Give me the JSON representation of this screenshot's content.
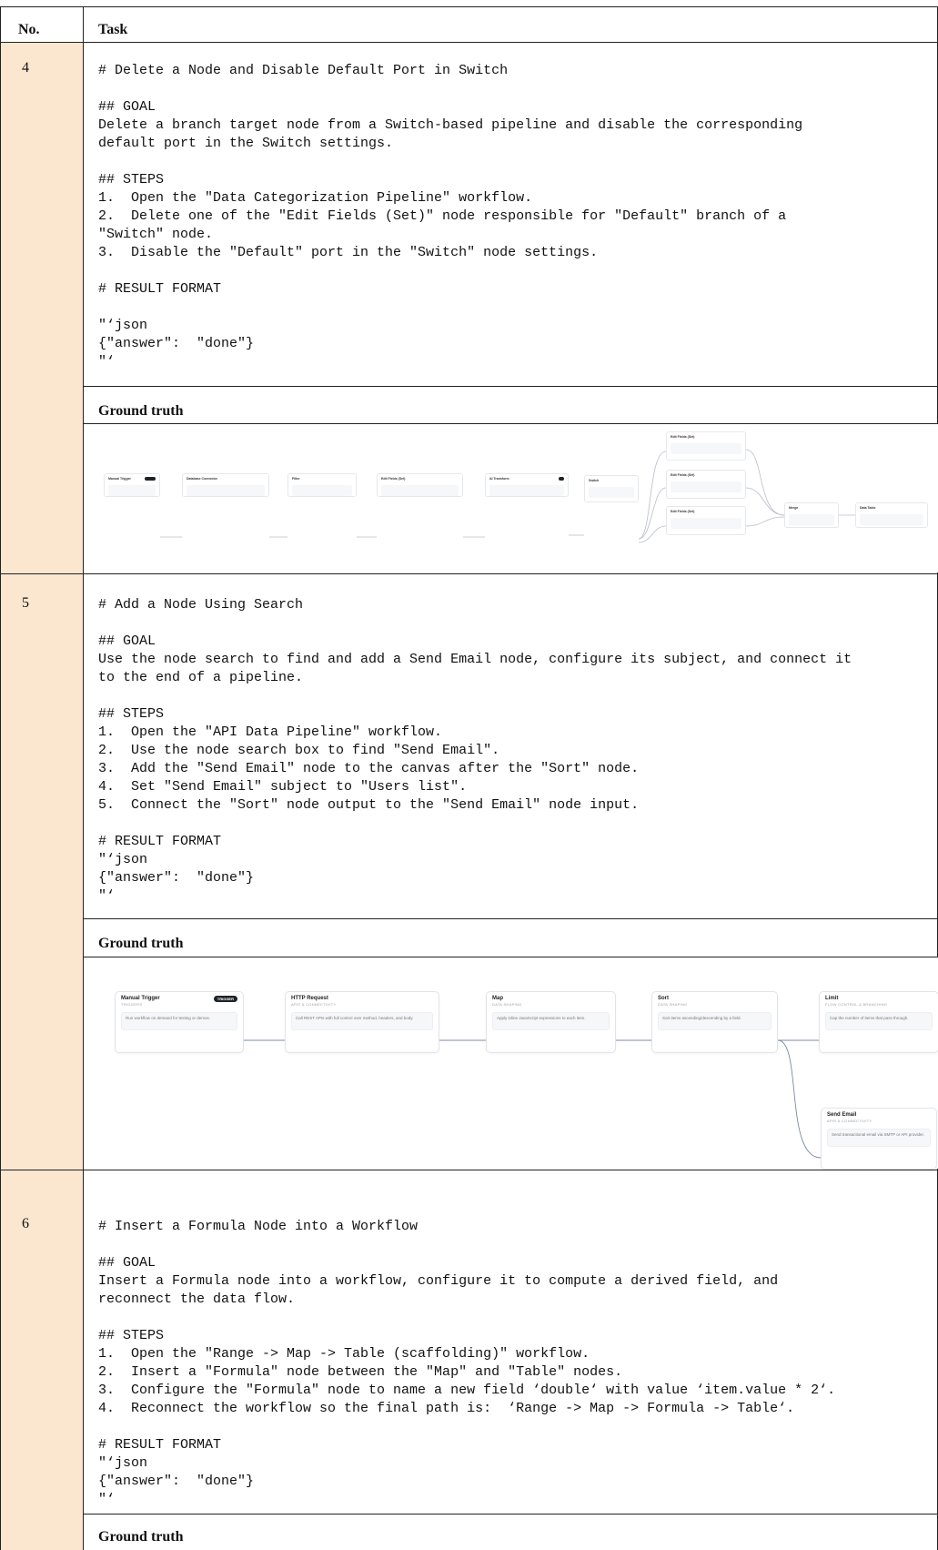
{
  "table": {
    "headers": {
      "no": "No.",
      "task": "Task"
    },
    "ground_truth_label": "Ground truth",
    "rows": [
      {
        "no": "4",
        "task_text": "# Delete a Node and Disable Default Port in Switch\n\n## GOAL\nDelete a branch target node from a Switch-based pipeline and disable the corresponding\ndefault port in the Switch settings.\n\n## STEPS\n1.  Open the \"Data Categorization Pipeline\" workflow.\n2.  Delete one of the \"Edit Fields (Set)\" node responsible for \"Default\" branch of a\n\"Switch\" node.\n3.  Disable the \"Default\" port in the \"Switch\" node settings.\n\n# RESULT FORMAT\n\n\"‘json\n{\"answer\":  \"done\"}\n\"‘"
      },
      {
        "no": "5",
        "task_text": "# Add a Node Using Search\n\n## GOAL\nUse the node search to find and add a Send Email node, configure its subject, and connect it\nto the end of a pipeline.\n\n## STEPS\n1.  Open the \"API Data Pipeline\" workflow.\n2.  Use the node search box to find \"Send Email\".\n3.  Add the \"Send Email\" node to the canvas after the \"Sort\" node.\n4.  Set \"Send Email\" subject to \"Users list\".\n5.  Connect the \"Sort\" node output to the \"Send Email\" node input.\n\n# RESULT FORMAT\n\"‘json\n{\"answer\":  \"done\"}\n\"‘"
      },
      {
        "no": "6",
        "task_text": "# Insert a Formula Node into a Workflow\n\n## GOAL\nInsert a Formula node into a workflow, configure it to compute a derived field, and\nreconnect the data flow.\n\n## STEPS\n1.  Open the \"Range -> Map -> Table (scaffolding)\" workflow.\n2.  Insert a \"Formula\" node between the \"Map\" and \"Table\" nodes.\n3.  Configure the \"Formula\" node to name a new field ‘double‘ with value ‘item.value * 2‘.\n4.  Reconnect the workflow so the final path is:  ‘Range -> Map -> Formula -> Table‘.\n\n# RESULT FORMAT\n\"‘json\n{\"answer\":  \"done\"}\n\"‘"
      }
    ]
  },
  "figure1": {
    "nodes": [
      {
        "title": "Manual Trigger",
        "badge": true
      },
      {
        "title": "Database Connector"
      },
      {
        "title": "Filter"
      },
      {
        "title": "Edit Fields (Set)"
      },
      {
        "title": "AI Transform",
        "badge": true
      },
      {
        "title": "Switch"
      },
      {
        "title": "Edit Fields (Set)"
      },
      {
        "title": "Edit Fields (Set)"
      },
      {
        "title": "Edit Fields (Set)"
      },
      {
        "title": "Merge"
      },
      {
        "title": "Data Table"
      }
    ]
  },
  "figure2": {
    "nodes": [
      {
        "title": "Manual Trigger",
        "category": "TRIGGERS",
        "badge": "TRIGGER",
        "desc": "Run workflow on demand for testing or demos."
      },
      {
        "title": "HTTP Request",
        "category": "APIS & CONNECTIVITY",
        "desc": "Call REST APIs with full control over method, headers, and body."
      },
      {
        "title": "Map",
        "category": "DATA SHAPING",
        "desc": "Apply inline JavaScript expressions to each item."
      },
      {
        "title": "Sort",
        "category": "DATA SHAPING",
        "desc": "Sort items ascending/descending by a field."
      },
      {
        "title": "Limit",
        "category": "FLOW CONTROL & BRANCHING",
        "desc": "Cap the number of items that pass through."
      },
      {
        "title": "Send Email",
        "category": "APIS & CONNECTIVITY",
        "desc": "Send transactional email via SMTP or API provider."
      }
    ]
  }
}
